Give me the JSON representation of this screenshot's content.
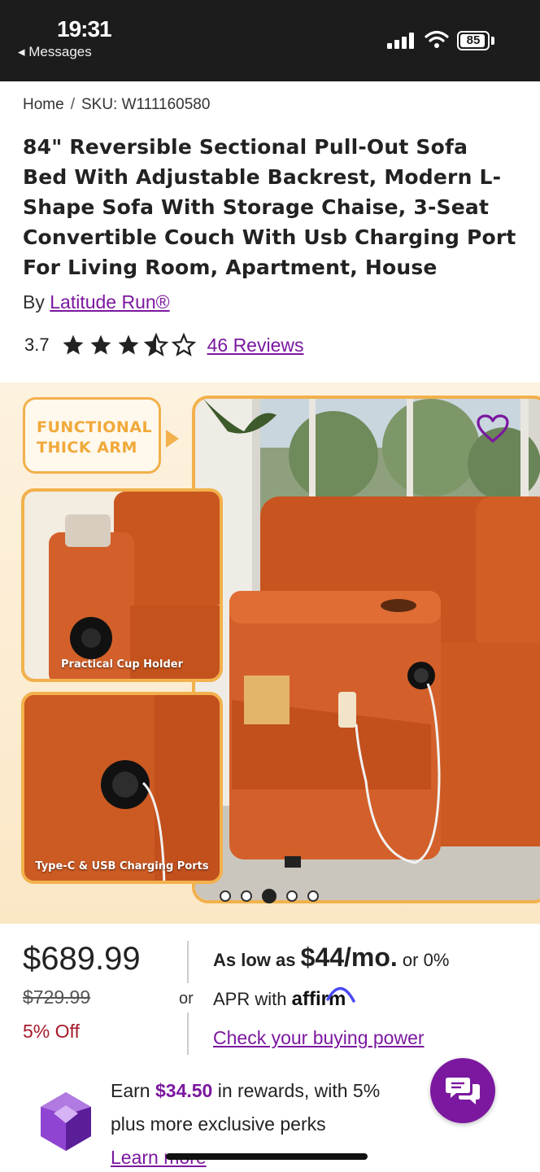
{
  "status_bar": {
    "time": "19:31",
    "back_app": "◂ Messages",
    "battery": "85"
  },
  "breadcrumb": {
    "home": "Home",
    "separator": "/",
    "sku": "SKU: W111160580"
  },
  "product": {
    "title": "84\" Reversible Sectional Pull-Out Sofa Bed With Adjustable Backrest, Modern L-Shape Sofa With Storage Chaise, 3-Seat Convertible Couch With Usb Charging Port For Living Room, Apartment, House",
    "by_label": "By",
    "brand": "Latitude Run®",
    "rating": "3.7",
    "rating_value": 3.7,
    "rating_max": 5,
    "reviews": "46 Reviews"
  },
  "gallery": {
    "callout": "FUNCTIONAL THICK ARM",
    "inset1_caption": "Practical Cup Holder",
    "inset2_caption": "Type-C & USB Charging Ports",
    "slide_count": 5,
    "active_slide": 3
  },
  "pricing": {
    "price": "$689.99",
    "was_price": "$729.99",
    "discount": "5% Off",
    "or": "or",
    "as_low_as": "As low as",
    "monthly": "$44/mo.",
    "or_zero": "or 0%",
    "apr_with": "APR with",
    "affirm": "affirm",
    "buying_power": "Check your buying power"
  },
  "rewards": {
    "earn": "Earn",
    "amount": "$34.50",
    "line1_rest": "in rewards, with 5%",
    "line2": "plus more exclusive perks",
    "learn_more": "Learn more"
  },
  "colors": {
    "accent_purple": "#7b189f",
    "discount_red": "#a61b2b",
    "callout_orange": "#f2b14c",
    "sofa_orange": "#cf5d24"
  }
}
